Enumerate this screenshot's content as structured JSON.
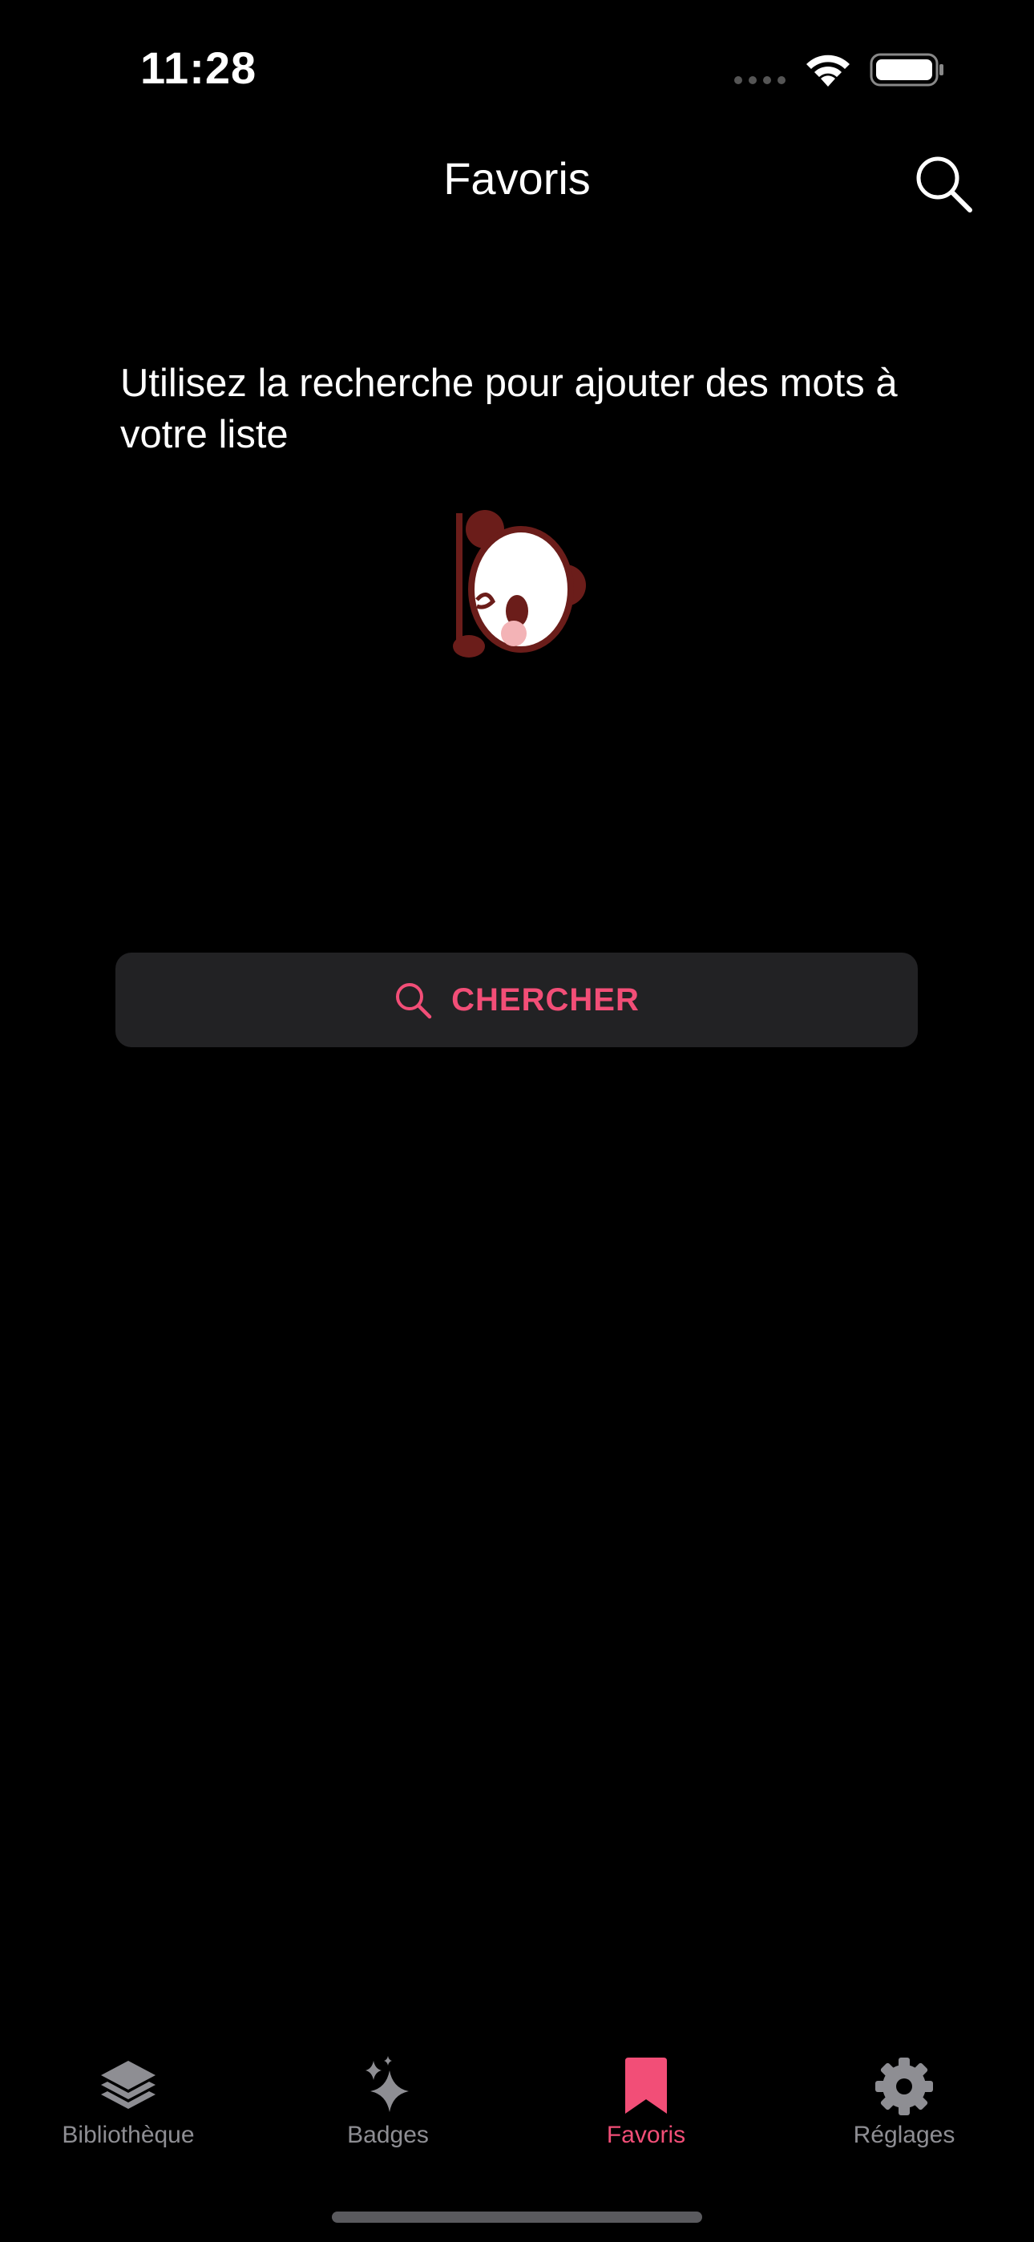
{
  "status_bar": {
    "time": "11:28"
  },
  "nav": {
    "title": "Favoris",
    "search_icon": "magnifier-icon"
  },
  "empty_state": {
    "message": "Utilisez la recherche pour ajouter des mots à votre liste",
    "mascot": "panda-peeking-illustration"
  },
  "search_button": {
    "label": "CHERCHER",
    "icon": "magnifier-icon"
  },
  "tabs": [
    {
      "label": "Bibliothèque",
      "icon": "layers-stack-icon",
      "active": false
    },
    {
      "label": "Badges",
      "icon": "sparkles-icon",
      "active": false
    },
    {
      "label": "Favoris",
      "icon": "bookmark-icon",
      "active": true
    },
    {
      "label": "Réglages",
      "icon": "gear-icon",
      "active": false
    }
  ],
  "colors": {
    "background": "#000000",
    "accent": "#f24e77",
    "tab_inactive": "#8e8e93",
    "button_background": "#222224"
  }
}
